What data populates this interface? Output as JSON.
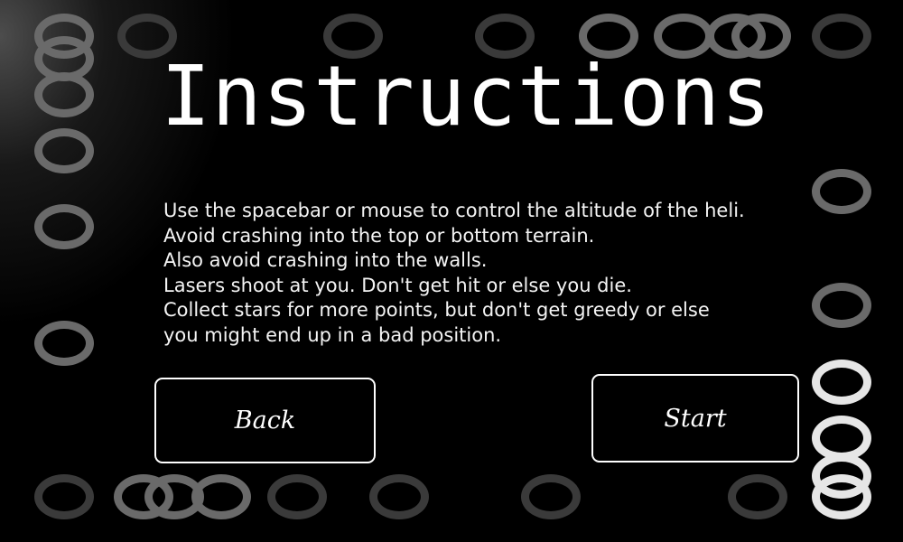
{
  "screen": {
    "title": "Instructions",
    "instructions": [
      "Use the spacebar or mouse to control the altitude of the heli.",
      "Avoid crashing into the top or bottom terrain.",
      "Also avoid crashing into the walls.",
      "Lasers shoot at you. Don't get hit or else you die.",
      "Collect stars for more points, but don't get greedy or else",
      "you might end up in a bad position."
    ]
  },
  "buttons": {
    "back_label": "Back",
    "start_label": "Start"
  },
  "colors": {
    "background": "#000000",
    "text": "#ffffff",
    "ring_dim": "#3a3a3a",
    "ring_mid": "#6a6a6a",
    "ring_bright": "#e6e6e6"
  }
}
